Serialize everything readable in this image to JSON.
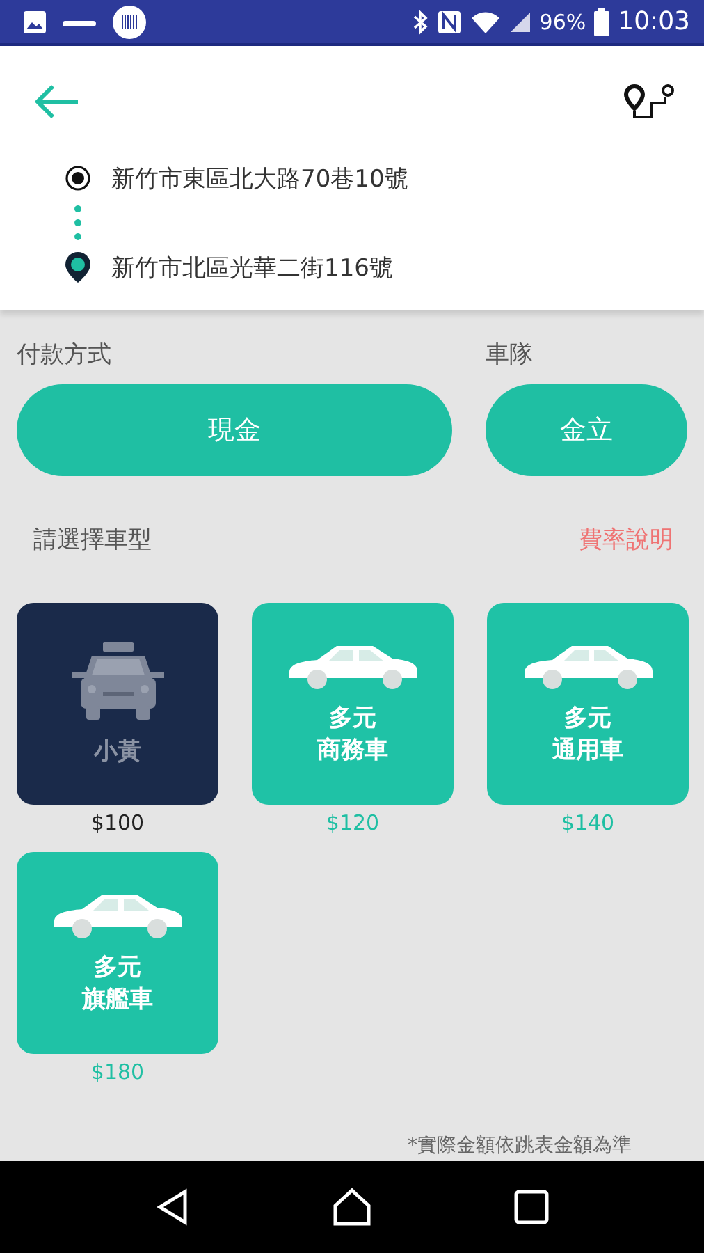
{
  "status_bar": {
    "battery": "96%",
    "time": "10:03"
  },
  "route": {
    "origin": "新竹市東區北大路70巷10號",
    "destination": "新竹市北區光華二街116號"
  },
  "payment": {
    "label": "付款方式",
    "value": "現金"
  },
  "fleet": {
    "label": "車隊",
    "value": "金立"
  },
  "vehicle_section": {
    "title": "請選擇車型",
    "rate_link": "費率說明"
  },
  "vehicles": [
    {
      "kind": "taxi",
      "name": [
        "小黃"
      ],
      "price": "$100",
      "selected": true
    },
    {
      "kind": "sedan",
      "name": [
        "多元",
        "商務車"
      ],
      "price": "$120",
      "selected": false
    },
    {
      "kind": "sedan",
      "name": [
        "多元",
        "通用車"
      ],
      "price": "$140",
      "selected": false
    },
    {
      "kind": "sedan",
      "name": [
        "多元",
        "旗艦車"
      ],
      "price": "$180",
      "selected": false
    }
  ],
  "footnote": "*實際金額依跳表金額為準"
}
